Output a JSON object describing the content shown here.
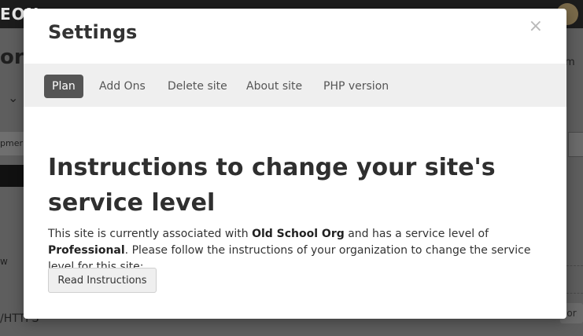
{
  "background": {
    "logo_text": "EON",
    "page_title_fragment": "orl",
    "input_fragment": "pmer",
    "left_text_w": "w",
    "left_text_https": "/HTTPS",
    "right_text_m": "m",
    "right_input_text": "Cor"
  },
  "modal": {
    "title": "Settings",
    "close_label": "×",
    "tabs": [
      {
        "label": "Plan",
        "active": true
      },
      {
        "label": "Add Ons",
        "active": false
      },
      {
        "label": "Delete site",
        "active": false
      },
      {
        "label": "About site",
        "active": false
      },
      {
        "label": "PHP version",
        "active": false
      }
    ],
    "heading": "Instructions to change your site's service level",
    "description": {
      "part1": "This site is currently associated with ",
      "org_name": "Old School Org",
      "part2": " and has a service level of ",
      "service_level": "Professional",
      "part3": ". Please follow the instructions of your organization to change the service level for this site:"
    },
    "read_button_label": "Read Instructions"
  }
}
